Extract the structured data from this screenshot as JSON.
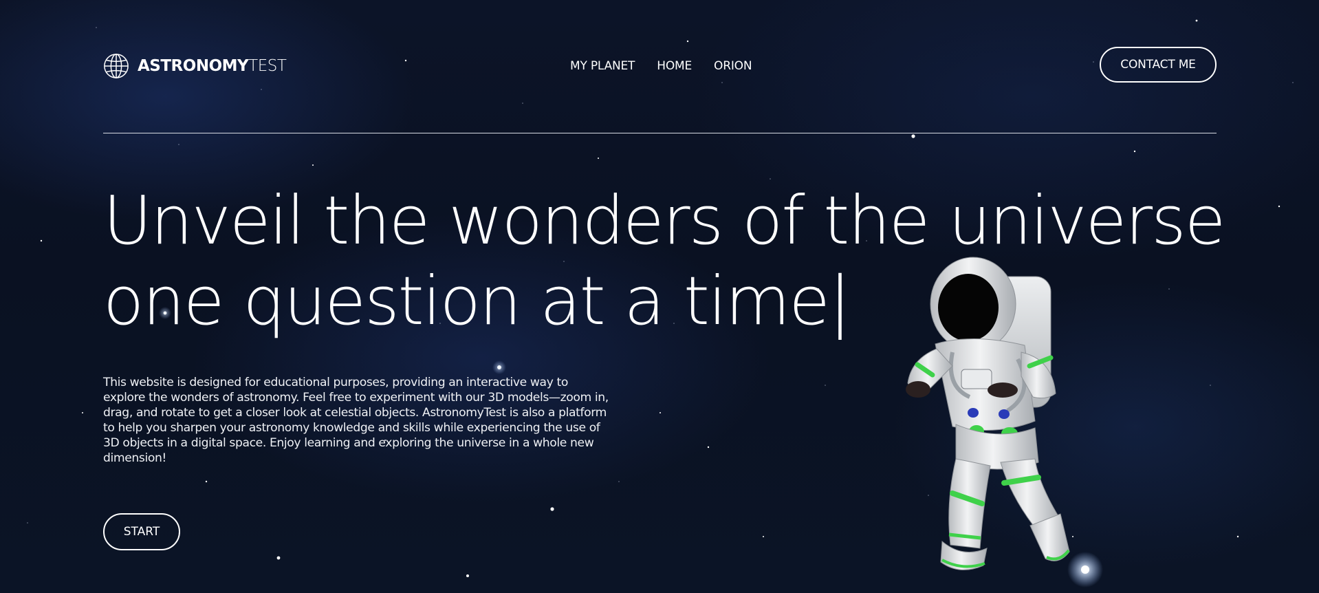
{
  "header": {
    "brand_bold": "ASTRONOMY",
    "brand_light": "TEST",
    "logo_icon": "globe-icon",
    "nav": [
      "MY PLANET",
      "HOME",
      "ORION"
    ],
    "contact_label": "CONTACT ME"
  },
  "hero": {
    "title": "Unveil the wonders of the universe one question at a time",
    "caret": "|",
    "description": "This website is designed for educational purposes, providing an interactive way to explore the wonders of astronomy. Feel free to experiment with our 3D models—zoom in, drag, and rotate to get a closer look at celestial objects. AstronomyTest is also a platform to help you sharpen your astronomy knowledge and skills while experiencing the use of 3D objects in a digital space. Enjoy learning and exploring the universe in a whole new dimension!",
    "start_label": "START",
    "model": "astronaut-3d-model"
  },
  "colors": {
    "background": "#0b1326",
    "text": "#ffffff",
    "suit_accent": "#3fd14a"
  }
}
